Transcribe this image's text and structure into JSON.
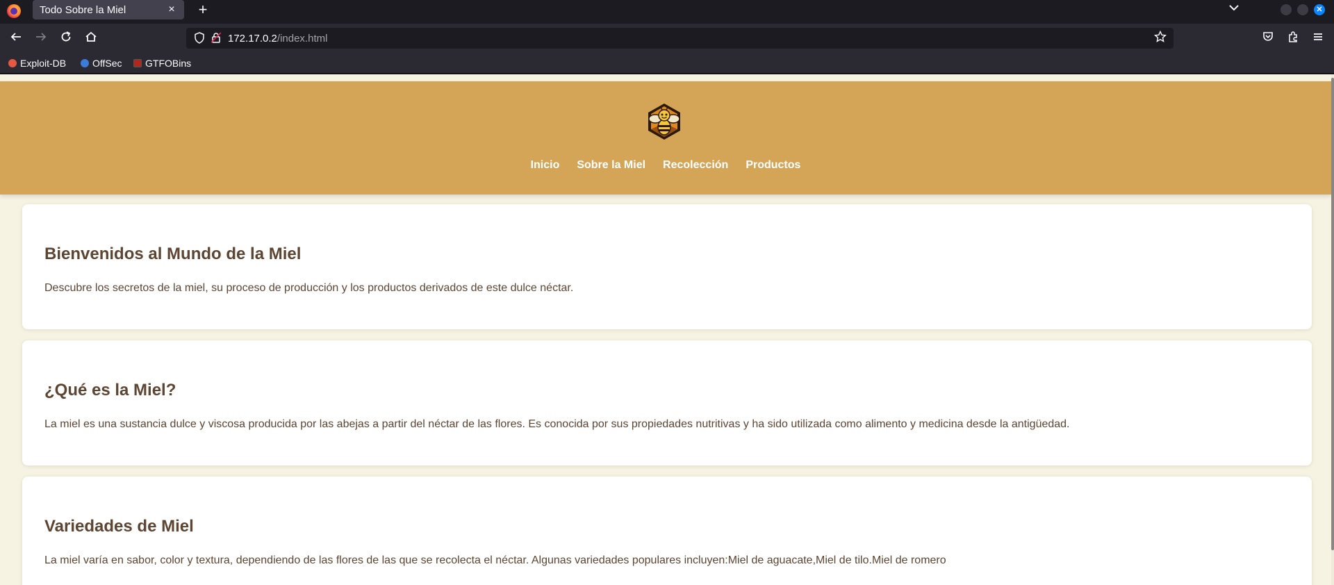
{
  "browser": {
    "tab_title": "Todo Sobre la Miel",
    "tab_close": "×",
    "new_tab": "+",
    "url_host": "172.17.0.2",
    "url_path": "/index.html",
    "bookmarks": [
      {
        "label": "Exploit-DB",
        "color": "#e8573f"
      },
      {
        "label": "OffSec",
        "color": "#3b7bd9"
      },
      {
        "label": "GTFOBins",
        "color": "#b3261e"
      }
    ],
    "icons": [
      "firefox-icon",
      "back-icon",
      "forward-icon",
      "reload-icon",
      "home-icon",
      "shield-icon",
      "lock-icon",
      "star-icon",
      "pocket-icon",
      "extensions-icon",
      "menu-icon"
    ]
  },
  "site": {
    "nav": [
      "Inicio",
      "Sobre la Miel",
      "Recolección",
      "Productos"
    ],
    "sections": [
      {
        "title": "Bienvenidos al Mundo de la Miel",
        "text": "Descubre los secretos de la miel, su proceso de producción y los productos derivados de este dulce néctar."
      },
      {
        "title": "¿Qué es la Miel?",
        "text": "La miel es una sustancia dulce y viscosa producida por las abejas a partir del néctar de las flores. Es conocida por sus propiedades nutritivas y ha sido utilizada como alimento y medicina desde la antigüedad."
      },
      {
        "title": "Variedades de Miel",
        "text": "La miel varía en sabor, color y textura, dependiendo de las flores de las que se recolecta el néctar. Algunas variedades populares incluyen:Miel de aguacate,Miel de tilo.Miel de romero"
      }
    ]
  },
  "colors": {
    "header": "#d4a556",
    "page_bg": "#f7f3e3",
    "text": "#5d4532"
  }
}
